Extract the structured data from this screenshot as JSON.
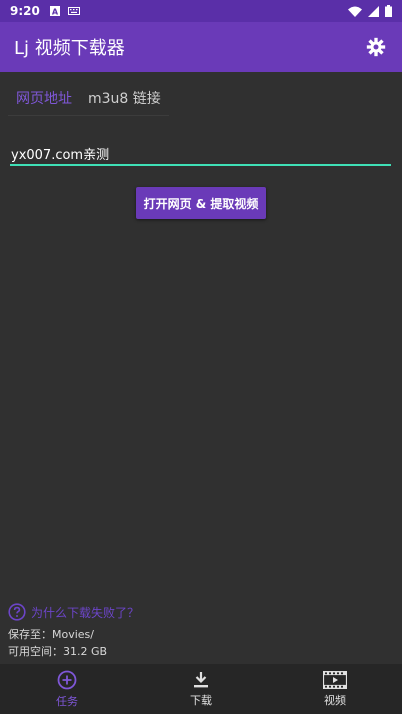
{
  "status_bar": {
    "time": "9:20",
    "icons": [
      "a-notification-icon",
      "keyboard-icon",
      "wifi-icon",
      "signal-icon",
      "battery-icon"
    ]
  },
  "app_bar": {
    "title": "Lj 视频下载器",
    "settings_icon": "gear-icon"
  },
  "tabs": [
    {
      "label": "网页地址",
      "active": true
    },
    {
      "label": "m3u8 链接",
      "active": false
    }
  ],
  "url_input": {
    "value": "yx007.com亲测"
  },
  "open_button": {
    "label": "打开网页 & 提取视频"
  },
  "help": {
    "icon": "question-circle-icon",
    "text": "为什么下载失败了？"
  },
  "storage": {
    "save_path": "保存至：Movies/",
    "free_space": "可用空间：31.2 GB"
  },
  "bottom_nav": [
    {
      "label": "任务",
      "icon": "plus-circle-icon",
      "active": true
    },
    {
      "label": "下载",
      "icon": "download-icon",
      "active": false
    },
    {
      "label": "视频",
      "icon": "film-icon",
      "active": false
    }
  ],
  "colors": {
    "status_bar": "#5a2fa8",
    "app_bar": "#6a3ab8",
    "accent": "#7f57d8",
    "input_underline": "#3fe0b6",
    "background": "#303030",
    "bottom_nav": "#262626"
  }
}
